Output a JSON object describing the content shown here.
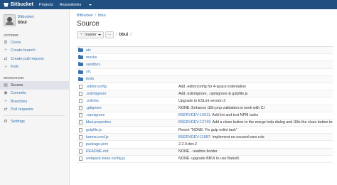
{
  "topbar": {
    "brand": "Bitbucket",
    "nav": [
      "Projects",
      "Repositories"
    ]
  },
  "sidebar": {
    "owner": "Bitbucket",
    "repo": "bbui",
    "actions_label": "ACTIONS",
    "actions": [
      {
        "label": "Clone",
        "icon": "clone-icon"
      },
      {
        "label": "Create branch",
        "icon": "branch-icon"
      },
      {
        "label": "Create pull request",
        "icon": "pull-request-icon"
      },
      {
        "label": "Fork",
        "icon": "fork-icon"
      }
    ],
    "navigation_label": "NAVIGATION",
    "navigation": [
      {
        "label": "Source",
        "icon": "source-icon",
        "active": true
      },
      {
        "label": "Commits",
        "icon": "commits-icon"
      },
      {
        "label": "Branches",
        "icon": "branches-icon"
      },
      {
        "label": "Pull requests",
        "icon": "pull-requests-icon"
      }
    ],
    "settings": {
      "label": "Settings",
      "icon": "gear-icon"
    }
  },
  "breadcrumb": [
    "Bitbucket",
    "bbui"
  ],
  "page_title": "Source",
  "toolbar": {
    "branch": "master",
    "more": "···",
    "path_sep": "/",
    "path_current": "bbui",
    "path_trail": "/"
  },
  "files": [
    {
      "type": "folder",
      "name": "etc",
      "key": "",
      "msg": ""
    },
    {
      "type": "folder",
      "name": "mocks",
      "key": "",
      "msg": ""
    },
    {
      "type": "folder",
      "name": "sandbox",
      "key": "",
      "msg": ""
    },
    {
      "type": "folder",
      "name": "src",
      "key": "",
      "msg": ""
    },
    {
      "type": "folder",
      "name": "tests",
      "key": "",
      "msg": ""
    },
    {
      "type": "file",
      "name": ".editorconfig",
      "key": "",
      "msg": "Add .editorconfig for 4-space indentation"
    },
    {
      "type": "file",
      "name": ".eslintignore",
      "key": "",
      "msg": "Add .eslintignore, .npmignore & gulpfile.js"
    },
    {
      "type": "file",
      "name": ".eslintrc",
      "key": "",
      "msg": "Upgrade to ESLint version 2"
    },
    {
      "type": "file",
      "name": ".gitignore",
      "key": "",
      "msg": "NONE: Enhance i18n pnp validation to work with CI"
    },
    {
      "type": "file",
      "name": ".npmignore",
      "key": "BSERVDEV-10911:",
      "msg": " Add lint and test NPM tasks"
    },
    {
      "type": "file",
      "name": "bbui.properties",
      "key": "BSERVDEV-12743:",
      "msg": " Add a close button to the merge help dialog and i18n the close button text"
    },
    {
      "type": "file",
      "name": "gulpfile.js",
      "key": "",
      "msg": "Revert \"NONE: Fix gulp eslint task\""
    },
    {
      "type": "file",
      "name": "karma.conf.js",
      "key": "BSERVDEV-11687:",
      "msg": " Implement no-unused-vars rule"
    },
    {
      "type": "file",
      "name": "package.json",
      "key": "",
      "msg": "2.2.0-dev.2"
    },
    {
      "type": "file",
      "name": "README.md",
      "key": "",
      "msg": "NONE - readme border"
    },
    {
      "type": "file",
      "name": "webpack-base.config.js",
      "key": "",
      "msg": "NONE: upgrade BBUI to use Babel6"
    }
  ],
  "colors": {
    "topbar": "#205081",
    "link": "#3572b0",
    "folder": "#3b73af"
  }
}
